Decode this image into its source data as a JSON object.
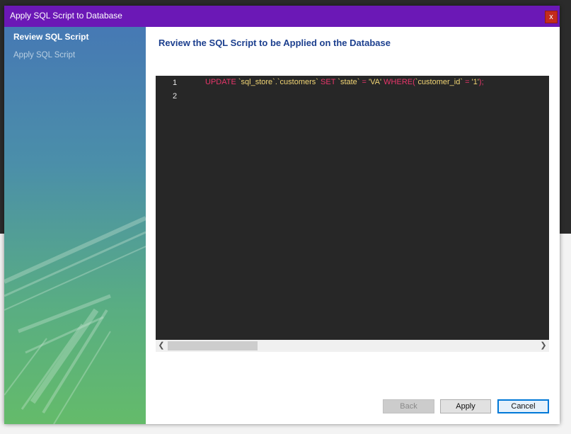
{
  "dialog": {
    "title": "Apply SQL Script to Database",
    "close_label": "x"
  },
  "sidebar": {
    "steps": [
      {
        "label": "Review SQL Script",
        "active": true
      },
      {
        "label": "Apply SQL Script",
        "active": false
      }
    ]
  },
  "main": {
    "heading": "Review the SQL Script to be Applied on the Database"
  },
  "editor": {
    "line_numbers": [
      "1",
      "2"
    ],
    "tokens": {
      "update": "UPDATE",
      "table": "`sql_store`.`customers`",
      "set": "SET",
      "column": "`state`",
      "eq1": "=",
      "value": "'VA'",
      "where": "WHERE",
      "paren_open": "(",
      "where_col": "`customer_id`",
      "eq2": "=",
      "where_val": "'1'",
      "tail": ");"
    }
  },
  "buttons": {
    "back": "Back",
    "apply": "Apply",
    "cancel": "Cancel"
  },
  "colors": {
    "titlebar": "#6b18b6",
    "keyword": "#e8366a",
    "string": "#f2d574",
    "heading": "#1c3f8e"
  }
}
